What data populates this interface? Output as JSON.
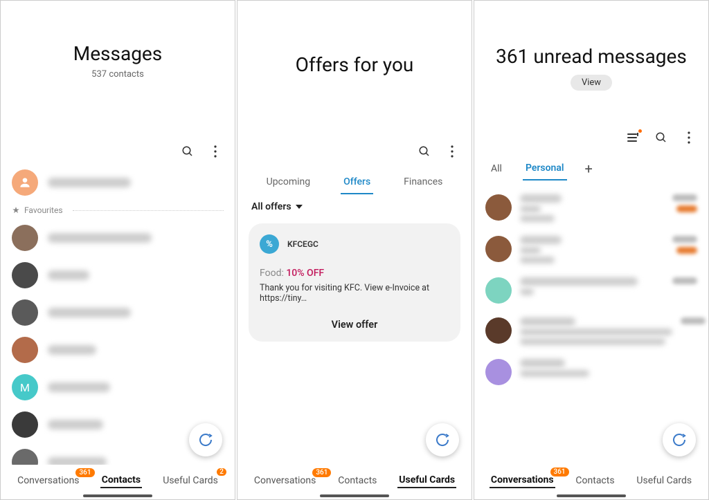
{
  "screen1": {
    "title": "Messages",
    "subtitle": "537 contacts",
    "favourites_label": "Favourites",
    "contacts": [
      {
        "color": "#f5a97a",
        "letter": ""
      },
      {
        "color": "#8b6f5c",
        "letter": ""
      },
      {
        "color": "#4a4a4a",
        "letter": ""
      },
      {
        "color": "#5a5a5a",
        "letter": ""
      },
      {
        "color": "#b36b4a",
        "letter": ""
      },
      {
        "color": "#46c9c9",
        "letter": "M"
      },
      {
        "color": "#3a3a3a",
        "letter": ""
      },
      {
        "color": "#6a6a6a",
        "letter": ""
      }
    ]
  },
  "screen2": {
    "title": "Offers for you",
    "tabs": [
      "Upcoming",
      "Offers",
      "Finances"
    ],
    "active_tab": "Offers",
    "dropdown": "All offers",
    "offer": {
      "sender": "KFCEGC",
      "category": "Food:",
      "discount": "10% OFF",
      "body": "Thank you for visiting KFC. View e-Invoice at https://tiny…",
      "cta": "View offer"
    }
  },
  "screen3": {
    "title": "361 unread messages",
    "view_label": "View",
    "filter_tabs": [
      "All",
      "Personal"
    ],
    "active_filter": "Personal",
    "conversations": [
      {
        "avatar_color": "#8b5a3c",
        "has_draft": true
      },
      {
        "avatar_color": "#8b5a3c",
        "has_draft": true
      },
      {
        "avatar_color": "#7dd4c0",
        "has_draft": false
      },
      {
        "avatar_color": "#5a3a2a",
        "has_draft": false
      },
      {
        "avatar_color": "#a890e0",
        "has_draft": false
      }
    ]
  },
  "nav": {
    "conversations": "Conversations",
    "contacts": "Contacts",
    "useful_cards": "Useful Cards",
    "badge_conv": "361",
    "badge_cards": "2"
  }
}
